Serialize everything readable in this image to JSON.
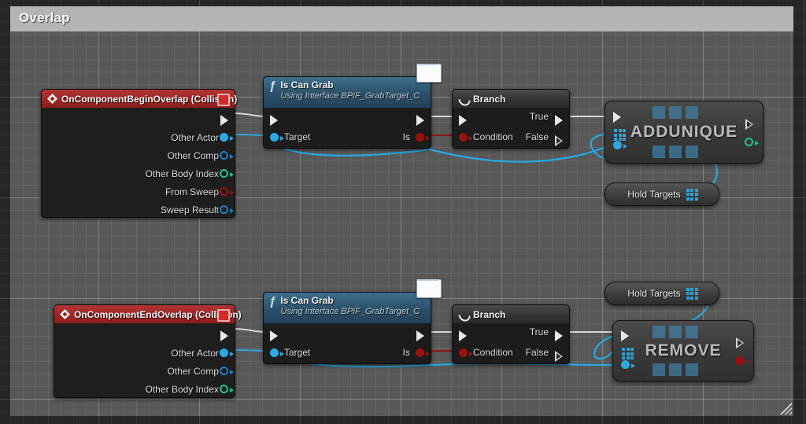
{
  "comment": {
    "title": "Overlap",
    "grip_icon": "resize-grip-icon"
  },
  "colors": {
    "event_header": "#a02424",
    "function_header": "#2c4f68",
    "branch_header": "#333333",
    "exec_wire": "#d7d7d7",
    "object_wire": "#2aa9e0",
    "bool_wire": "#8f1414",
    "array_pin": "#2f9fd6"
  },
  "nodes": {
    "begin_overlap": {
      "title": "OnComponentBeginOverlap (Collision)",
      "icon": "event-diamond-icon",
      "delete_icon": "event-delete-icon",
      "exec_out_label": "",
      "outputs": [
        {
          "label": "Other Actor",
          "type": "object"
        },
        {
          "label": "Other Comp",
          "type": "struct"
        },
        {
          "label": "Other Body Index",
          "type": "int"
        },
        {
          "label": "From Sweep",
          "type": "bool"
        },
        {
          "label": "Sweep Result",
          "type": "struct"
        }
      ]
    },
    "is_can_grab_top": {
      "title": "Is Can Grab",
      "subtitle": "Using Interface BPIF_GrabTarget_C",
      "icon": "function-f-icon",
      "message_icon": "envelope-icon",
      "input_label": "Target",
      "output_label": "Is"
    },
    "branch_top": {
      "title": "Branch",
      "icon": "branch-icon",
      "condition_label": "Condition",
      "true_label": "True",
      "false_label": "False"
    },
    "addunique": {
      "label": "ADDUNIQUE",
      "array_icon": "array-grid-icon"
    },
    "hold_targets_top": {
      "label": "Hold Targets",
      "array_icon": "array-grid-icon"
    },
    "end_overlap": {
      "title": "OnComponentEndOverlap (Collision)",
      "icon": "event-diamond-icon",
      "delete_icon": "event-delete-icon",
      "outputs": [
        {
          "label": "Other Actor",
          "type": "object"
        },
        {
          "label": "Other Comp",
          "type": "struct"
        },
        {
          "label": "Other Body Index",
          "type": "int"
        }
      ]
    },
    "is_can_grab_bottom": {
      "title": "Is Can Grab",
      "subtitle": "Using Interface BPIF_GrabTarget_C",
      "icon": "function-f-icon",
      "message_icon": "envelope-icon",
      "input_label": "Target",
      "output_label": "Is"
    },
    "branch_bottom": {
      "title": "Branch",
      "icon": "branch-icon",
      "condition_label": "Condition",
      "true_label": "True",
      "false_label": "False"
    },
    "remove": {
      "label": "REMOVE",
      "array_icon": "array-grid-icon"
    },
    "hold_targets_bottom": {
      "label": "Hold Targets",
      "array_icon": "array-grid-icon"
    }
  }
}
